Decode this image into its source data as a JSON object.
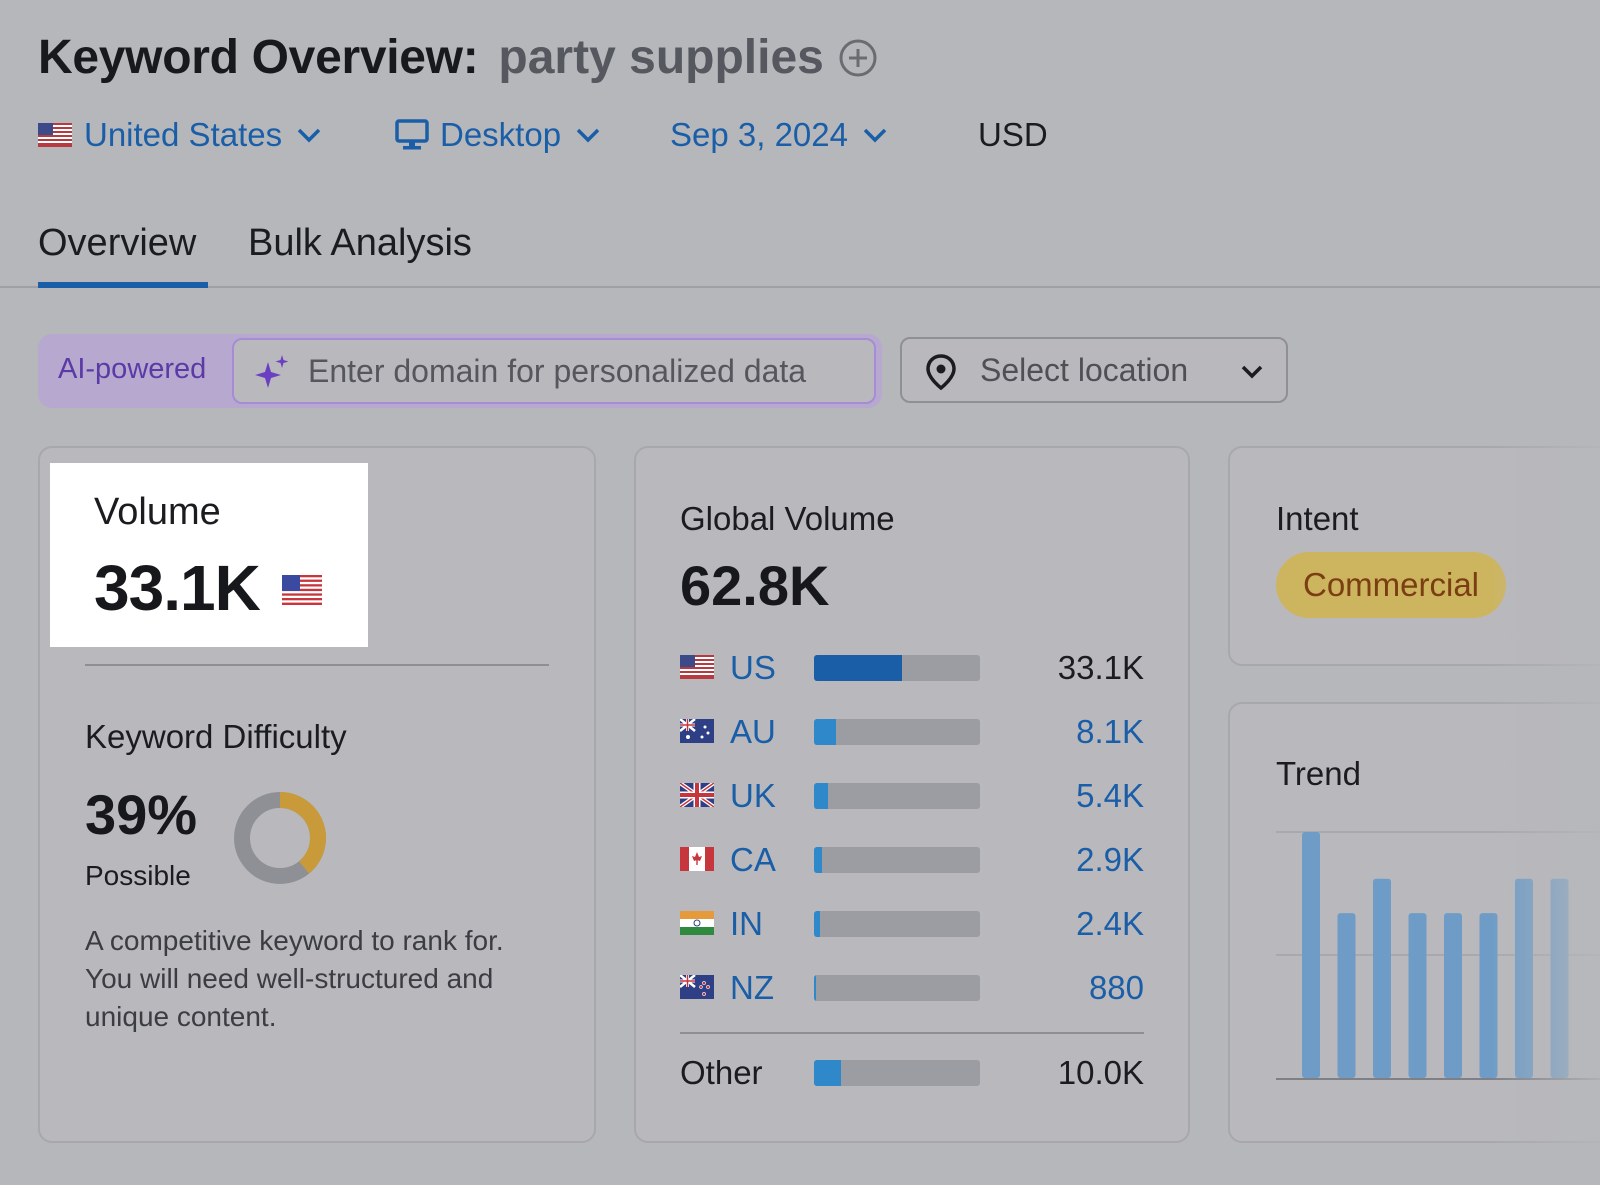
{
  "header": {
    "title": "Keyword Overview:",
    "keyword": "party supplies"
  },
  "filters": {
    "country": "United States",
    "device": "Desktop",
    "date": "Sep 3, 2024",
    "currency": "USD"
  },
  "tabs": [
    {
      "label": "Overview",
      "active": true
    },
    {
      "label": "Bulk Analysis",
      "active": false
    }
  ],
  "ai_bar": {
    "label": "AI-powered",
    "placeholder": "Enter domain for personalized data"
  },
  "location_select": {
    "placeholder": "Select location"
  },
  "volume": {
    "label": "Volume",
    "value": "33.1K"
  },
  "keyword_difficulty": {
    "label": "Keyword Difficulty",
    "value": "39%",
    "percent": 39,
    "level": "Possible",
    "description": "A competitive keyword to rank for. You will need well-structured and unique content."
  },
  "global_volume": {
    "label": "Global Volume",
    "value": "62.8K",
    "countries": [
      {
        "code": "US",
        "value": "33.1K",
        "share": 0.53
      },
      {
        "code": "AU",
        "value": "8.1K",
        "share": 0.13
      },
      {
        "code": "UK",
        "value": "5.4K",
        "share": 0.086
      },
      {
        "code": "CA",
        "value": "2.9K",
        "share": 0.046
      },
      {
        "code": "IN",
        "value": "2.4K",
        "share": 0.038
      },
      {
        "code": "NZ",
        "value": "880",
        "share": 0.014
      }
    ],
    "other": {
      "label": "Other",
      "value": "10.0K",
      "share": 0.16
    }
  },
  "intent": {
    "label": "Intent",
    "value": "Commercial"
  },
  "trend": {
    "label": "Trend",
    "chart_data": {
      "type": "bar",
      "values": [
        1.0,
        0.67,
        0.81,
        0.67,
        0.67,
        0.67,
        0.81,
        0.81
      ],
      "ylim": [
        0,
        1
      ]
    }
  },
  "colors": {
    "link": "#1a5ea8",
    "bar_us": "#1a5ea8",
    "bar_other": "#2e88c9",
    "intent_badge": "#cdb55f",
    "donut_fill": "#c99a3a",
    "trend_bar": "#6e9cc6"
  }
}
